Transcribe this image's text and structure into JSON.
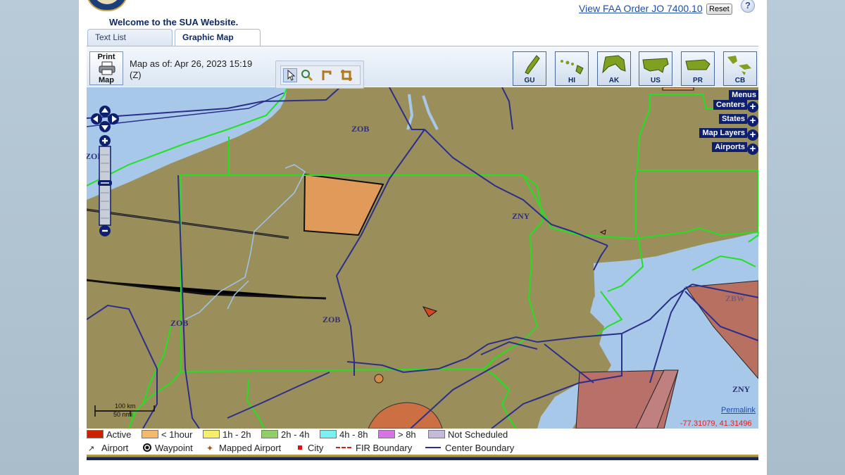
{
  "header": {
    "welcome": "Welcome to the SUA Website.",
    "faa_link": "View FAA Order JO 7400.10",
    "reset": "Reset",
    "help": "?"
  },
  "tabs": [
    {
      "label": "Text List",
      "active": false
    },
    {
      "label": "Graphic Map",
      "active": true
    }
  ],
  "toolbar": {
    "print_top": "Print",
    "print_bottom": "Map",
    "map_date": "Map as of: Apr 26, 2023 15:19 (Z)",
    "tools": [
      "select-tool",
      "zoom-tool",
      "measure-tool",
      "crop-tool"
    ]
  },
  "regions": [
    "GU",
    "HI",
    "AK",
    "US",
    "PR",
    "CB"
  ],
  "map": {
    "background_color": "#9a8f5a",
    "water_color": "#a8c8ea",
    "boundary_color": "#2c2f8a",
    "state_color": "#22e022",
    "labels": [
      "ZOB",
      "ZOB",
      "ZOB",
      "ZNY",
      "ZBW",
      "ZNY",
      "ZOB"
    ],
    "panel": [
      "Menus",
      "Centers",
      "States",
      "Map Layers",
      "Airports"
    ],
    "permalink": "Permalink",
    "coords": "-77.31079, 41.31496",
    "scale_km": "100 km",
    "scale_nmi": "50 nmi"
  },
  "legend": {
    "row1": [
      {
        "label": "Active",
        "color": "#cc2200"
      },
      {
        "label": "< 1hour",
        "color": "#f4b96b"
      },
      {
        "label": "1h - 2h",
        "color": "#f7ee6a"
      },
      {
        "label": "2h - 4h",
        "color": "#8fcf66"
      },
      {
        "label": "4h - 8h",
        "color": "#7af0f0"
      },
      {
        "label": "> 8h",
        "color": "#d674e6"
      },
      {
        "label": "Not Scheduled",
        "color": "#c2bad8"
      }
    ],
    "row2": [
      "Airport",
      "Waypoint",
      "Mapped Airport",
      "City",
      "FIR Boundary",
      "Center Boundary"
    ]
  }
}
